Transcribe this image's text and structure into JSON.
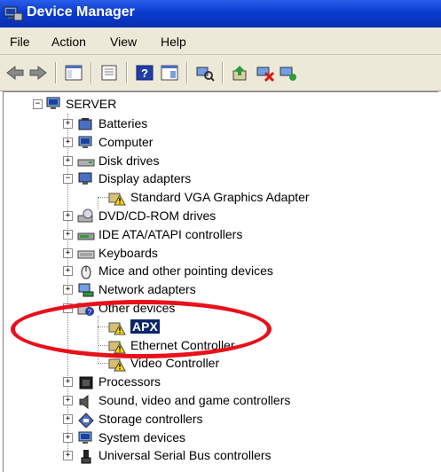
{
  "window": {
    "title": "Device Manager"
  },
  "menu": [
    "File",
    "Action",
    "View",
    "Help"
  ],
  "tree": {
    "root": "SERVER",
    "items": [
      {
        "label": "Batteries"
      },
      {
        "label": "Computer"
      },
      {
        "label": "Disk drives"
      },
      {
        "label": "Display adapters",
        "expanded": true
      },
      {
        "label": "Standard VGA Graphics Adapter",
        "child": true,
        "warning": true
      },
      {
        "label": "DVD/CD-ROM drives"
      },
      {
        "label": "IDE ATA/ATAPI controllers"
      },
      {
        "label": "Keyboards"
      },
      {
        "label": "Mice and other pointing devices"
      },
      {
        "label": "Network adapters"
      },
      {
        "label": "Other devices",
        "expanded": true
      },
      {
        "label": "APX",
        "child": true,
        "warning": true,
        "selected": true
      },
      {
        "label": "Ethernet Controller",
        "child": true,
        "warning": true
      },
      {
        "label": "Video Controller",
        "child": true,
        "warning": true
      },
      {
        "label": "Processors"
      },
      {
        "label": "Sound, video and game controllers"
      },
      {
        "label": "Storage controllers"
      },
      {
        "label": "System devices"
      },
      {
        "label": "Universal Serial Bus controllers"
      }
    ]
  },
  "colors": {
    "highlight": "#e8101a",
    "selection": "#0a246a",
    "titlebar": "#0a3bcf"
  }
}
